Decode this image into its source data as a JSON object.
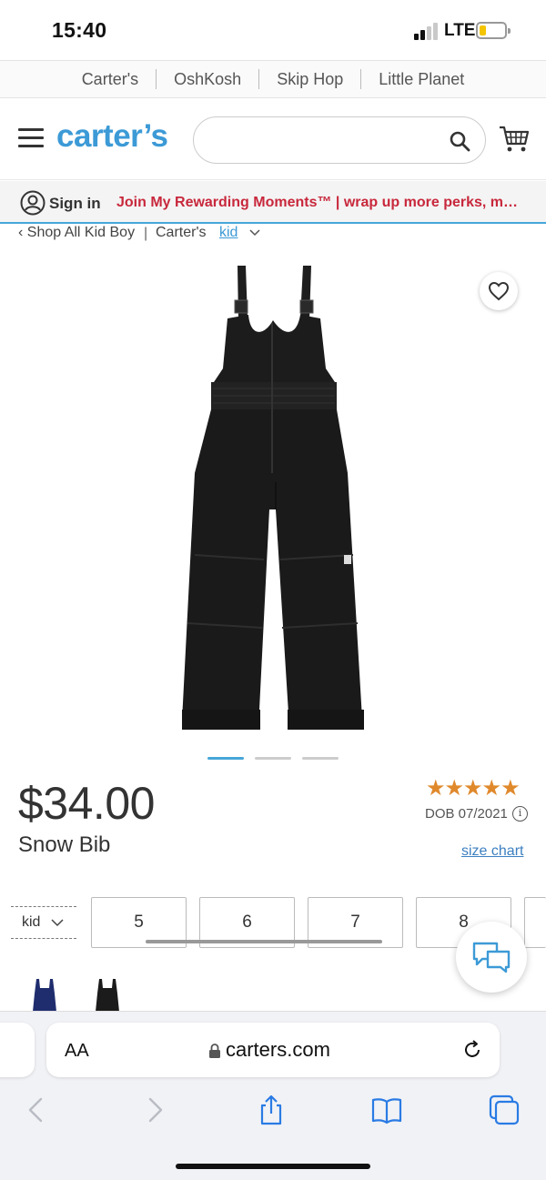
{
  "status": {
    "time": "15:40",
    "network": "LTE",
    "battery_level": 0.25
  },
  "brand_strip": {
    "items": [
      "Carter's",
      "OshKosh",
      "Skip Hop",
      "Little Planet"
    ]
  },
  "header": {
    "logo": "carter’s",
    "search_placeholder": ""
  },
  "signin_bar": {
    "signin_label": "Sign in",
    "promo": "Join My Rewarding Moments™ | wrap up more perks, m…"
  },
  "breadcrumb": {
    "back": "‹ Shop All Kid Boy",
    "separator": "|",
    "brand": "Carter's",
    "link": "kid"
  },
  "product": {
    "price": "$34.00",
    "name": "Snow Bib",
    "rating": "★★★★★",
    "rating_value": 5,
    "dob": "DOB 07/2021",
    "size_chart_label": "size chart",
    "size_type": "kid",
    "sizes": [
      "5",
      "6",
      "7",
      "8"
    ],
    "image_count": 3,
    "active_image": 1,
    "swatch_colors": [
      "#1f2d6e",
      "#1b1b1b"
    ]
  },
  "browser": {
    "aa_label": "AA",
    "url": "carters.com"
  }
}
